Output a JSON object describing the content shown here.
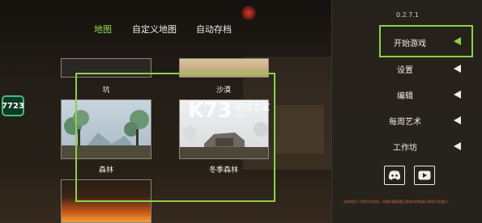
{
  "badge": "7723",
  "tabs": [
    {
      "label": "地图",
      "active": true
    },
    {
      "label": "自定义地图",
      "active": false
    },
    {
      "label": "自动存档",
      "active": false
    }
  ],
  "maps": [
    {
      "label": "坑"
    },
    {
      "label": "沙漠"
    },
    {
      "label": "森林"
    },
    {
      "label": "冬季森林"
    }
  ],
  "panel": {
    "version": "0.2.7.1",
    "menu": [
      {
        "label": "开始游戏"
      },
      {
        "label": "设置"
      },
      {
        "label": "编辑"
      },
      {
        "label": "每周艺术"
      },
      {
        "label": "工作坊"
      }
    ],
    "social": [
      "discord-icon",
      "youtube-icon"
    ],
    "footer": "该游戏处于早期访问阶段，如遇问题请通过游戏内的链接反馈给开发者们。"
  },
  "watermark": {
    "logo": "K73",
    "title": "游戏之家",
    "sub": ".com"
  },
  "colors": {
    "accent": "#8bd14a",
    "badge": "#3fbf7a"
  }
}
